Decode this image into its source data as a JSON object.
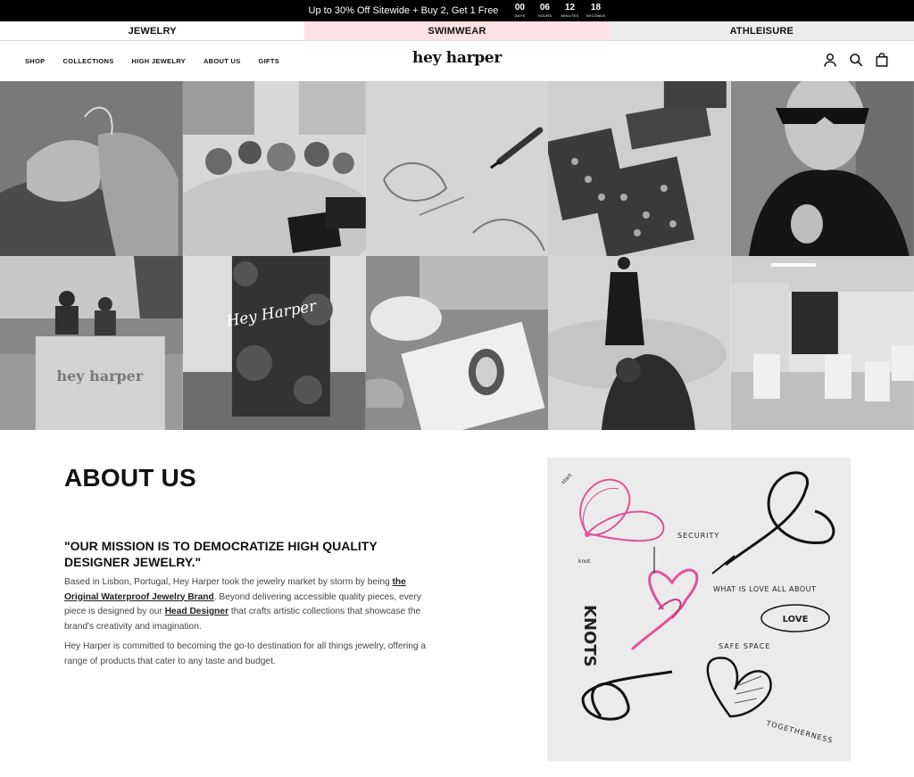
{
  "announcement": {
    "text": "Up to 30% Off Sitewide + Buy 2, Get 1 Free",
    "countdown": [
      {
        "value": "00",
        "label": "DAYS"
      },
      {
        "value": "06",
        "label": "HOURS"
      },
      {
        "value": "12",
        "label": "MINUTES"
      },
      {
        "value": "18",
        "label": "SECONDS"
      }
    ]
  },
  "category_tabs": [
    "JEWELRY",
    "SWIMWEAR",
    "ATHLEISURE"
  ],
  "header": {
    "nav": [
      "SHOP",
      "COLLECTIONS",
      "HIGH JEWELRY",
      "ABOUT US",
      "GIFTS"
    ],
    "logo": "hey harper",
    "icons": [
      "account-icon",
      "search-icon",
      "cart-icon"
    ]
  },
  "gallery": {
    "tile_text": {
      "neon_sign": "Hey Harper",
      "counter_sign": "hey harper"
    }
  },
  "about": {
    "title": "ABOUT US",
    "mission": "\"OUR MISSION IS TO DEMOCRATIZE HIGH QUALITY DESIGNER JEWELRY.\"",
    "p1_a": "Based in Lisbon, Portugal, Hey Harper took the jewelry market by storm by being ",
    "p1_link1": "the Original Waterproof Jewelry Brand",
    "p1_b": ". Beyond delivering accessible quality pieces, every piece is designed by our ",
    "p1_link2": "Head Designer",
    "p1_c": " that crafts artistic collections that showcase the brand's creativity and imagination.",
    "p2": "Hey Harper is committed to becoming the go-to destination for all things jewelry, offering a range of products that cater to any taste and budget."
  },
  "sketch_labels": {
    "top_left": "start",
    "knot": "knot",
    "security": "SECURITY",
    "love_question": "WHAT IS LOVE ALL ABOUT",
    "knots": "KNOTS",
    "love": "LOVE",
    "safe_space": "SAFE SPACE",
    "togetherness": "TOGETHERNESS"
  },
  "colors": {
    "announcement_bg": "#000000",
    "swimwear_tab": "#fde1e4",
    "athleisure_tab": "#ececec",
    "sketch_pink": "#e0529a"
  }
}
